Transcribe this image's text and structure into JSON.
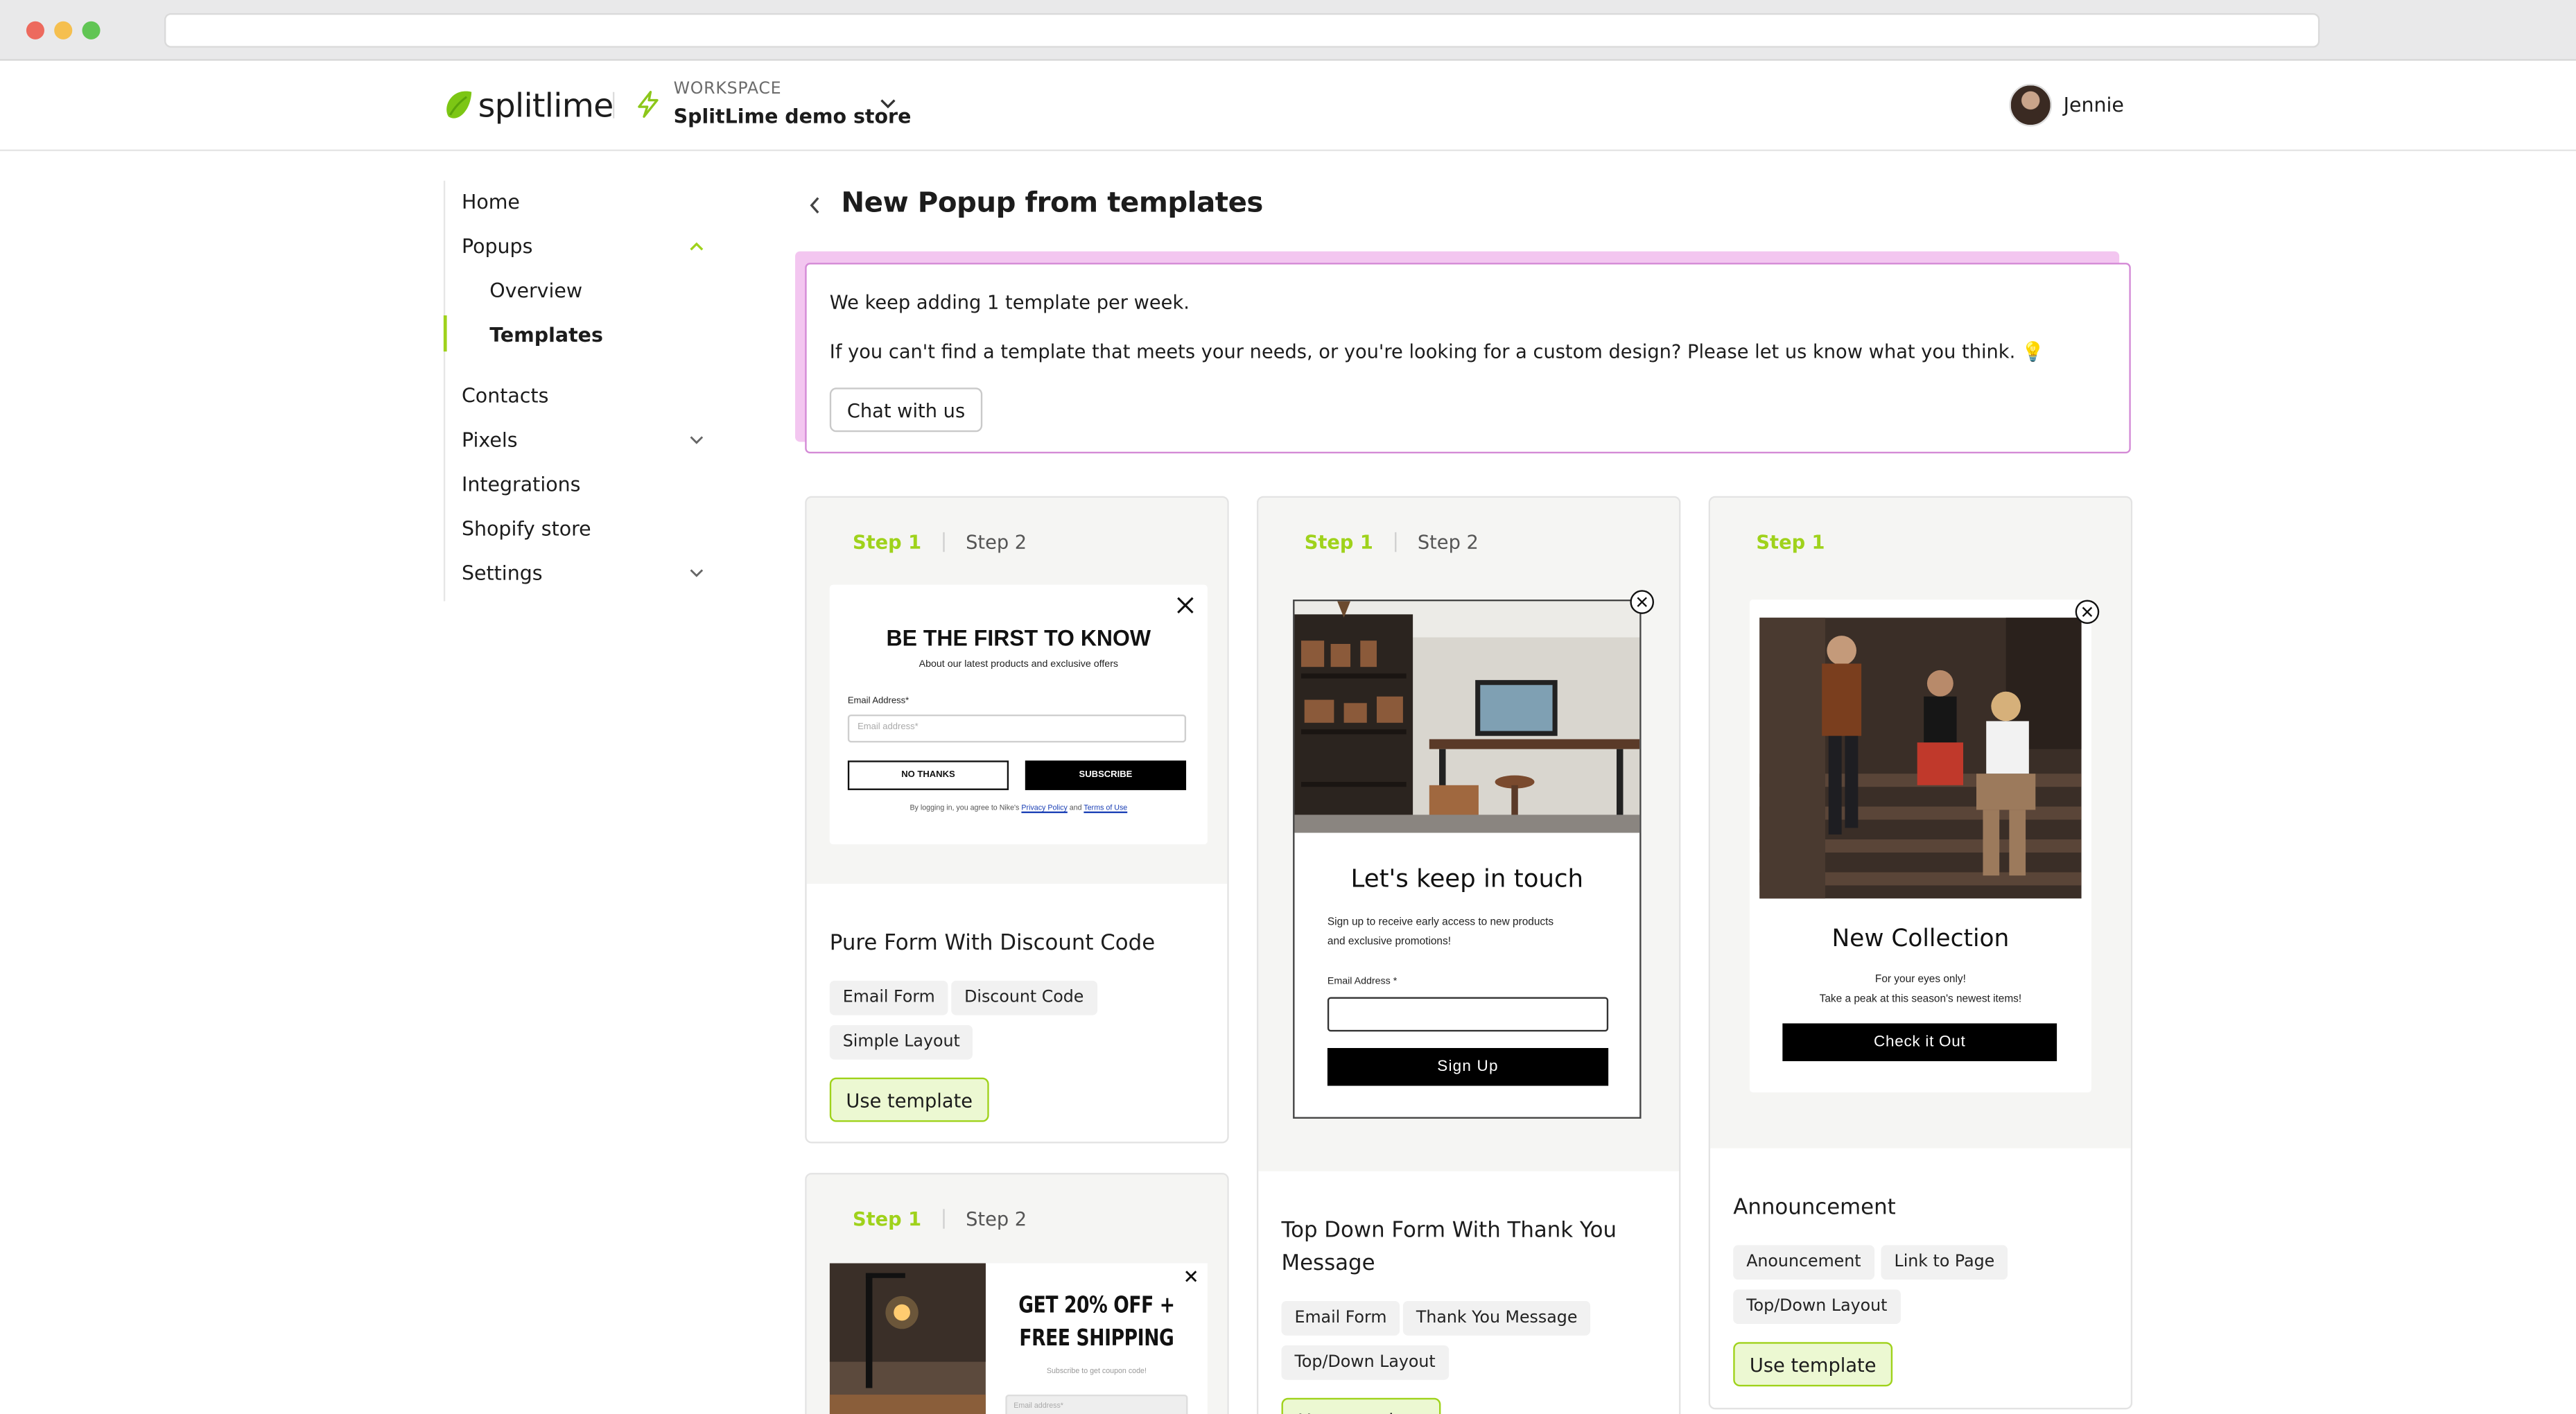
{
  "header": {
    "logo_text": "splitlime",
    "workspace_label": "WORKSPACE",
    "workspace_name": "SplitLime demo store",
    "user_name": "Jennie"
  },
  "sidebar": {
    "items": [
      {
        "label": "Home"
      },
      {
        "label": "Popups"
      },
      {
        "label": "Overview"
      },
      {
        "label": "Templates"
      },
      {
        "label": "Contacts"
      },
      {
        "label": "Pixels"
      },
      {
        "label": "Integrations"
      },
      {
        "label": "Shopify store"
      },
      {
        "label": "Settings"
      }
    ]
  },
  "page": {
    "title": "New Popup from templates"
  },
  "notice": {
    "line1": "We keep adding 1 template per week.",
    "line2": "If you can't find a template that meets your needs, or you're looking for a custom design? Please let us know what you think. 💡",
    "chat_button": "Chat with us"
  },
  "templates": [
    {
      "step1": "Step 1",
      "step2": "Step 2",
      "title": "Pure Form With Discount Code",
      "tags": [
        "Email Form",
        "Discount Code",
        "Simple Layout"
      ],
      "button": "Use template",
      "preview": {
        "heading": "BE THE FIRST TO KNOW",
        "sub": "About our latest products and exclusive offers",
        "email_label": "Email Address*",
        "email_placeholder": "Email address*",
        "no_thanks": "NO THANKS",
        "subscribe": "SUBSCRIBE",
        "legal_prefix": "By logging in, you agree to Nike's",
        "privacy": "Privacy Policy",
        "and": "and",
        "terms": "Terms of Use"
      }
    },
    {
      "step1": "Step 1",
      "step2": "Step 2",
      "title": "Top Down Form With Thank You Message",
      "tags": [
        "Email Form",
        "Thank You Message",
        "Top/Down Layout"
      ],
      "button": "Use template",
      "preview": {
        "heading": "Let's keep in touch",
        "sub1": "Sign up to receive early access to new products",
        "sub2": "and exclusive promotions!",
        "email_label": "Email Address *",
        "signup": "Sign Up"
      }
    },
    {
      "step1": "Step 1",
      "title": "Announcement",
      "tags": [
        "Anouncement",
        "Link to Page",
        "Top/Down Layout"
      ],
      "button": "Use template",
      "preview": {
        "heading": "New Collection",
        "sub1": "For your eyes only!",
        "sub2": "Take a peak at this season's newest items!",
        "cta": "Check it Out"
      }
    },
    {
      "step1": "Step 1",
      "step2": "Step 2",
      "preview": {
        "heading1": "GET 20% OFF +",
        "heading2": "FREE SHIPPING",
        "sub": "Subscribe to get coupon code!",
        "email_placeholder": "Email address*"
      }
    }
  ],
  "colors": {
    "brand_lime": "#9fd21b",
    "notice_border": "#d48ad6",
    "notice_shadow": "#f3c6f0",
    "use_button_bg": "#ecf8d2"
  }
}
